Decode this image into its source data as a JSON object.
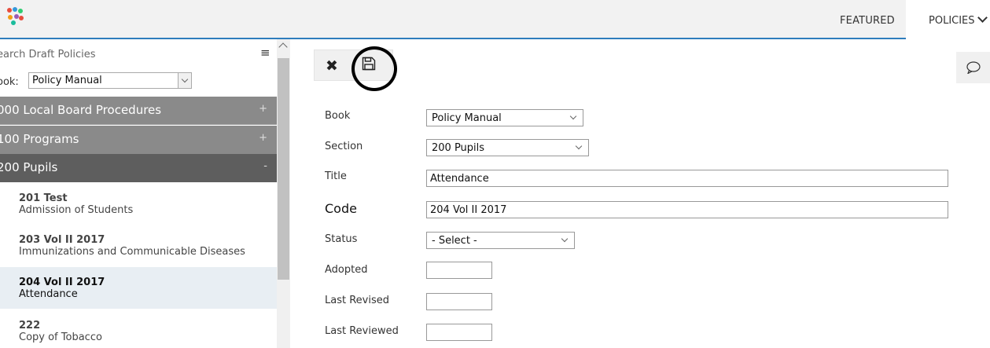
{
  "topnav": {
    "featured_label": "FEATURED",
    "policies_label": "POLICIES"
  },
  "sidebar": {
    "search_placeholder": "earch Draft Policies",
    "book_label": "ook:",
    "book_value": "Policy Manual",
    "sections": [
      {
        "label": "000 Local Board Procedures",
        "sign": "+"
      },
      {
        "label": "100 Programs",
        "sign": "+"
      },
      {
        "label": "200 Pupils",
        "sign": "-"
      }
    ],
    "policies": [
      {
        "code": "201 Test",
        "name": "Admission of Students"
      },
      {
        "code": "203 Vol II 2017",
        "name": "Immunizations and Communicable Diseases"
      },
      {
        "code": "204 Vol II 2017",
        "name": "Attendance"
      },
      {
        "code": "222",
        "name": "Copy of Tobacco"
      }
    ]
  },
  "form": {
    "book_label": "Book",
    "book_value": "Policy Manual",
    "section_label": "Section",
    "section_value": "200 Pupils",
    "title_label": "Title",
    "title_value": "Attendance",
    "code_label": "Code",
    "code_value": "204 Vol II 2017",
    "status_label": "Status",
    "status_value": "- Select -",
    "adopted_label": "Adopted",
    "adopted_value": "",
    "last_revised_label": "Last Revised",
    "last_revised_value": "",
    "last_reviewed_label": "Last Reviewed",
    "last_reviewed_value": ""
  },
  "colors": {
    "accent": "#2e7dbd",
    "section_collapsed": "#8a8a8a",
    "section_expanded": "#5e5e5e",
    "selected_item": "#e8eef3"
  },
  "icons": {
    "logo": "logo-icon",
    "close": "close-icon",
    "save": "save-icon",
    "chat": "chat-icon",
    "menu": "hamburger-icon"
  }
}
